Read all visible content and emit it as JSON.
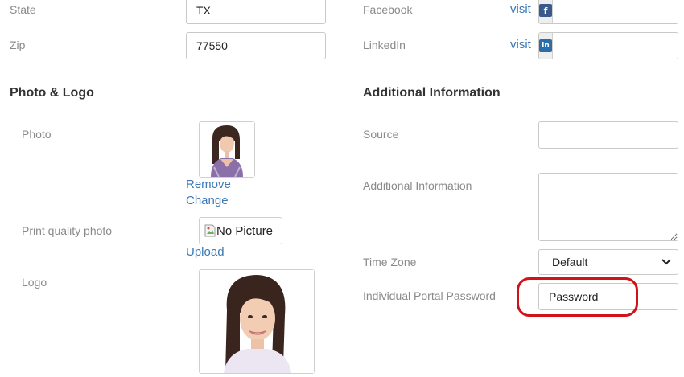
{
  "left": {
    "state_label": "State",
    "state_value": "TX",
    "zip_label": "Zip",
    "zip_value": "77550",
    "photo_section_title": "Photo & Logo",
    "photo_label": "Photo",
    "remove_link": "Remove",
    "change_link": "Change",
    "print_photo_label": "Print quality photo",
    "no_picture_alt": "No Picture",
    "upload_link": "Upload",
    "logo_label": "Logo"
  },
  "right": {
    "facebook_label": "Facebook",
    "facebook_visit": "visit",
    "facebook_icon": "facebook-icon",
    "facebook_value": "",
    "linkedin_label": "LinkedIn",
    "linkedin_visit": "visit",
    "linkedin_icon": "linkedin-icon",
    "linkedin_value": "",
    "additional_section_title": "Additional Information",
    "source_label": "Source",
    "source_value": "",
    "additional_info_label": "Additional Information",
    "additional_info_value": "",
    "timezone_label": "Time Zone",
    "timezone_value": "Default",
    "portal_password_label": "Individual Portal Password",
    "portal_password_value": "Password"
  },
  "colors": {
    "link": "#3a78b6",
    "highlight_ring": "#d0121a",
    "label_gray": "#8a8a8a"
  }
}
